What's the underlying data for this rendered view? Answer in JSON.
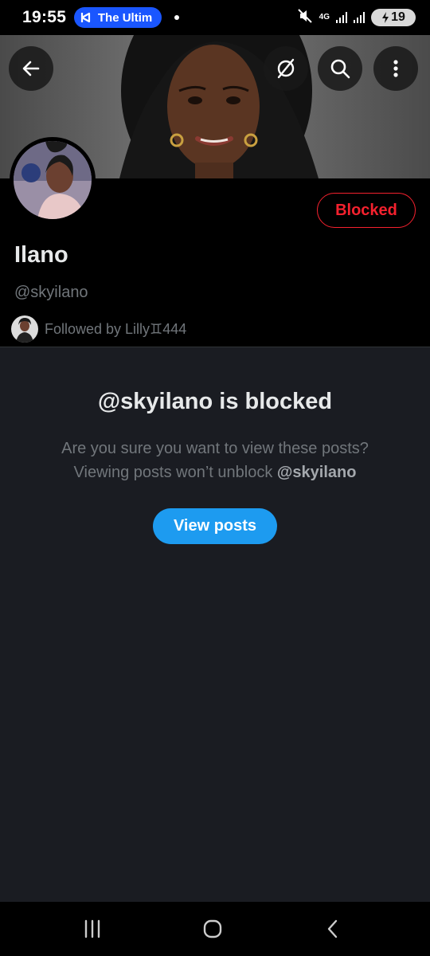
{
  "status_bar": {
    "time": "19:55",
    "notification_pill": "The Ultim",
    "network": "4G",
    "battery": "19"
  },
  "header": {
    "back_icon": "arrow-left-icon",
    "grok_icon": "slashed-circle-icon",
    "search_icon": "search-icon",
    "more_icon": "more-vertical-icon"
  },
  "profile": {
    "blocked_label": "Blocked",
    "name": "Ilano",
    "handle": "@skyilano",
    "followed_by": "Followed by Lilly♊444"
  },
  "blocked_notice": {
    "title": "@skyilano is blocked",
    "line1": "Are you sure you want to view these posts?",
    "line2_prefix": "Viewing posts won’t unblock ",
    "line2_handle": "@skyilano",
    "button_label": "View posts"
  },
  "colors": {
    "accent_blue": "#1d9bf0",
    "blocked_red": "#f4212e",
    "secondary_text": "#71767b",
    "content_bg": "#1a1c22"
  }
}
